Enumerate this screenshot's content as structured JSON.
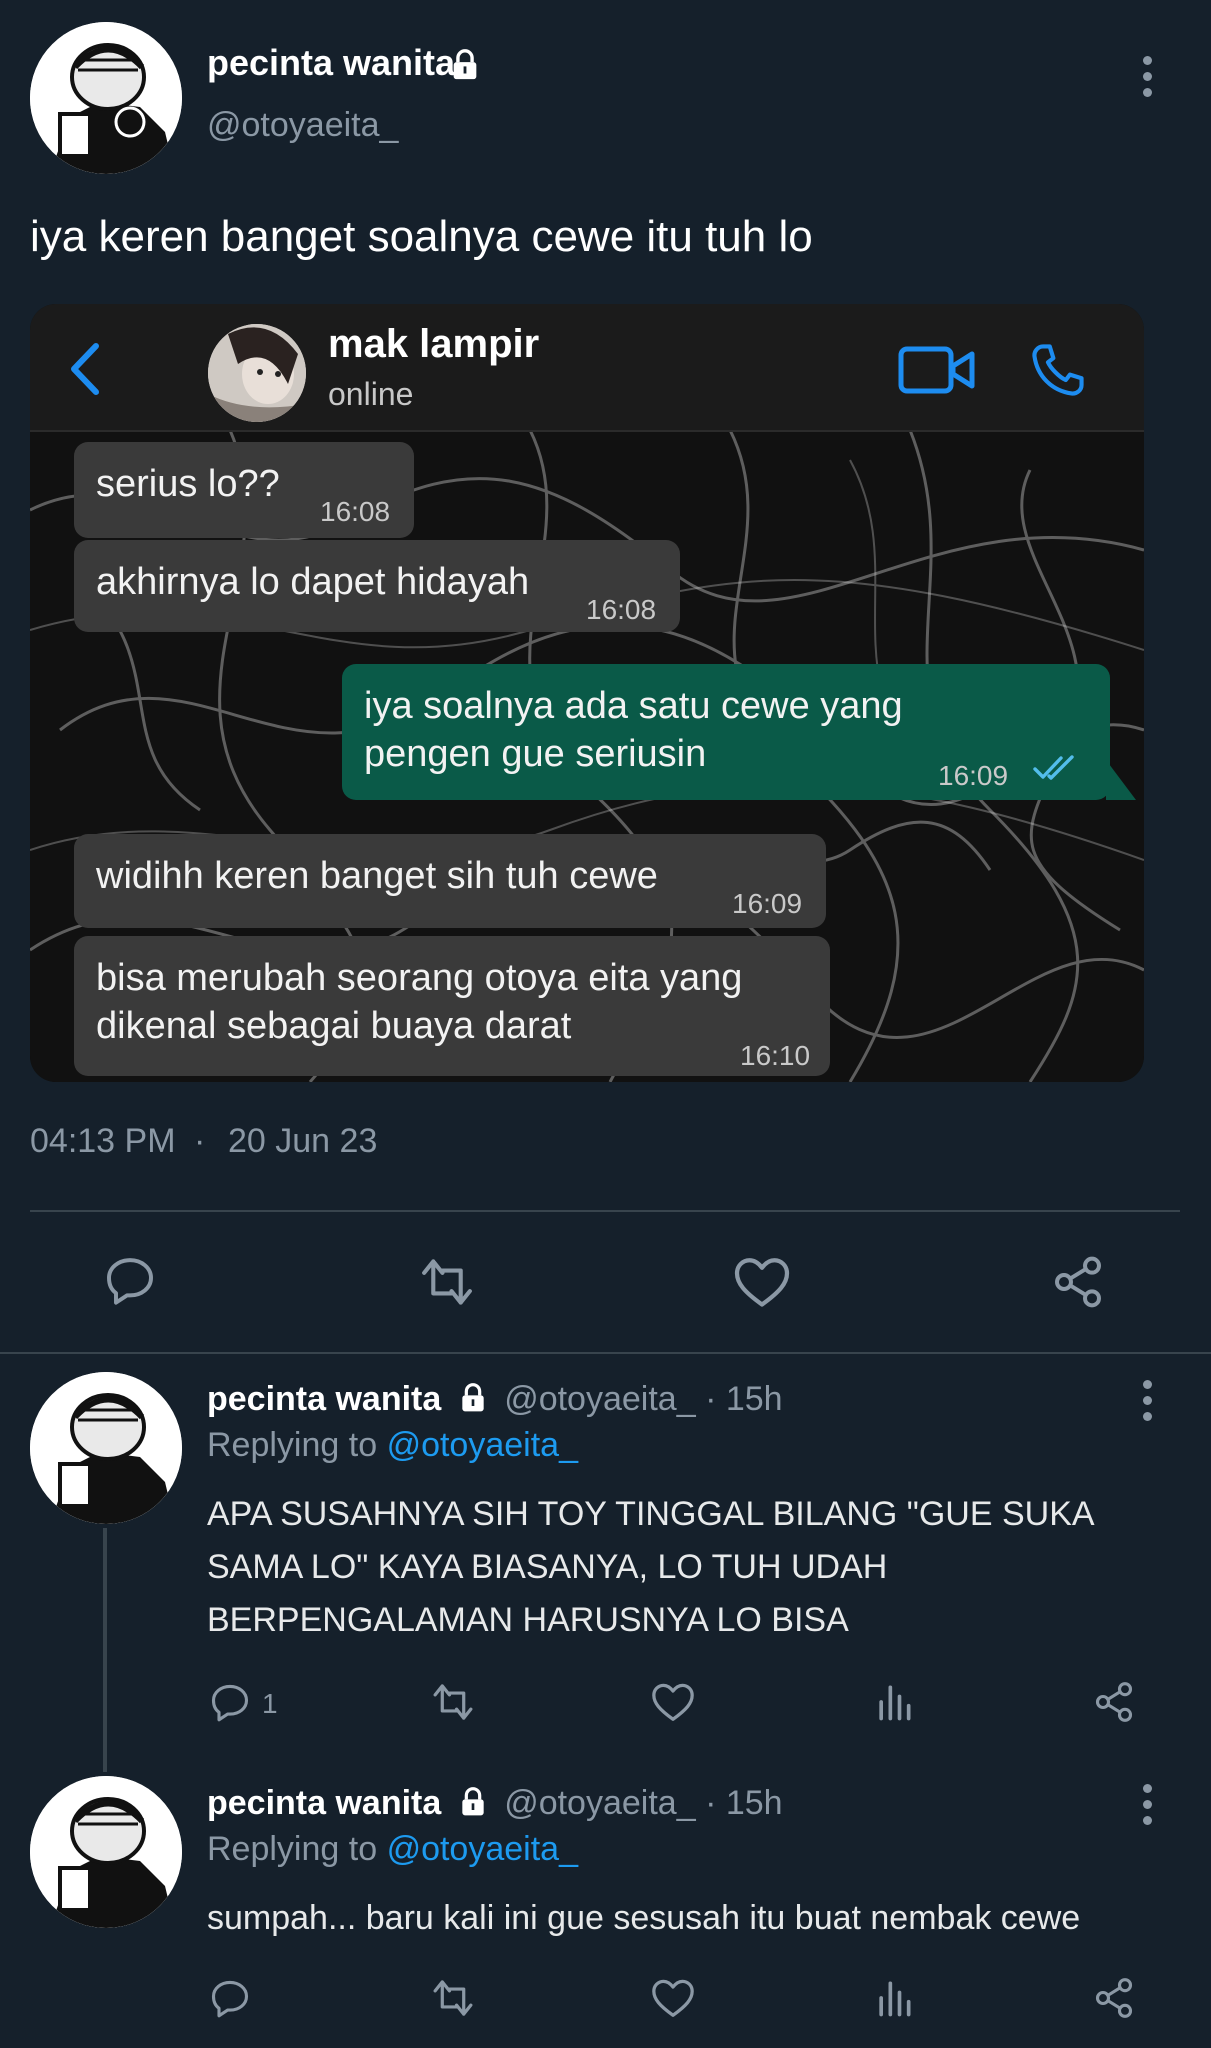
{
  "tweet": {
    "display_name": "pecinta wanita",
    "handle": "@otoyaeita_",
    "text": "iya keren banget soalnya cewe itu tuh lo",
    "time": "04:13 PM",
    "separator": "·",
    "date": "20 Jun 23",
    "icons": [
      "reply-icon",
      "retweet-icon",
      "like-icon",
      "share-icon"
    ]
  },
  "chat_screenshot": {
    "contact_name": "mak lampir",
    "status": "online",
    "messages": [
      {
        "direction": "in",
        "text": "serius lo??",
        "time": "16:08"
      },
      {
        "direction": "in",
        "text": "akhirnya lo dapet hidayah",
        "time": "16:08"
      },
      {
        "direction": "out",
        "text": "iya soalnya ada satu cewe yang pengen gue seriusin",
        "time": "16:09"
      },
      {
        "direction": "in",
        "text": "widihh keren banget sih tuh cewe",
        "time": "16:09"
      },
      {
        "direction": "in",
        "text": "bisa merubah seorang otoya eita yang dikenal sebagai buaya darat",
        "time": "16:10"
      }
    ],
    "colors": {
      "accent": "#1d8cf0",
      "outgoing_bubble": "#0a5a48",
      "incoming_bubble": "#3a3a3a"
    }
  },
  "replies": [
    {
      "display_name": "pecinta wanita",
      "handle": "@otoyaeita_",
      "age": "· 15h",
      "replying_label": "Replying to",
      "replying_to": "@otoyaeita_",
      "text": "APA SUSAHNYA SIH TOY TINGGAL BILANG \"GUE SUKA SAMA LO\" KAYA BIASANYA, LO TUH UDAH BERPENGALAMAN HARUSNYA LO BISA",
      "reply_count": "1"
    },
    {
      "display_name": "pecinta wanita",
      "handle": "@otoyaeita_",
      "age": "· 15h",
      "replying_label": "Replying to",
      "replying_to": "@otoyaeita_",
      "text": "sumpah... baru kali ini gue sesusah itu buat nembak cewe",
      "reply_count": ""
    }
  ],
  "theme": {
    "background": "#15202b",
    "link": "#1d9bf0",
    "muted": "#8b98a5"
  }
}
